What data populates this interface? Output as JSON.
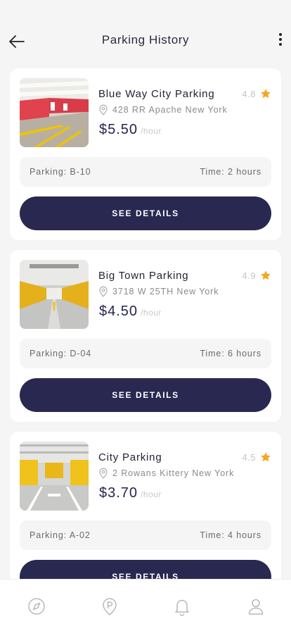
{
  "header": {
    "title": "Parking History",
    "back_icon": "arrow-left-icon",
    "menu_icon": "more-vertical-icon"
  },
  "parkings": [
    {
      "name": "Blue Way City Parking",
      "rating": "4.8",
      "address": "428 RR Apache New York",
      "price": "$5.50",
      "price_unit": "/hour",
      "parking_label": "Parking: B-10",
      "time_label": "Time: 2 hours",
      "button_label": "SEE DETAILS"
    },
    {
      "name": "Big Town Parking",
      "rating": "4.9",
      "address": "3718 W 25TH New York",
      "price": "$4.50",
      "price_unit": "/hour",
      "parking_label": "Parking: D-04",
      "time_label": "Time: 6 hours",
      "button_label": "SEE DETAILS"
    },
    {
      "name": "City Parking",
      "rating": "4.5",
      "address": "2 Rowans Kittery New York",
      "price": "$3.70",
      "price_unit": "/hour",
      "parking_label": "Parking: A-02",
      "time_label": "Time: 4 hours",
      "button_label": "SEE DETAILS"
    }
  ],
  "bottom_nav": [
    {
      "icon": "compass-icon"
    },
    {
      "icon": "parking-icon"
    },
    {
      "icon": "bell-icon"
    },
    {
      "icon": "user-icon"
    }
  ],
  "colors": {
    "primary": "#292850",
    "star": "#f5a623",
    "background": "#f5f5f5"
  }
}
